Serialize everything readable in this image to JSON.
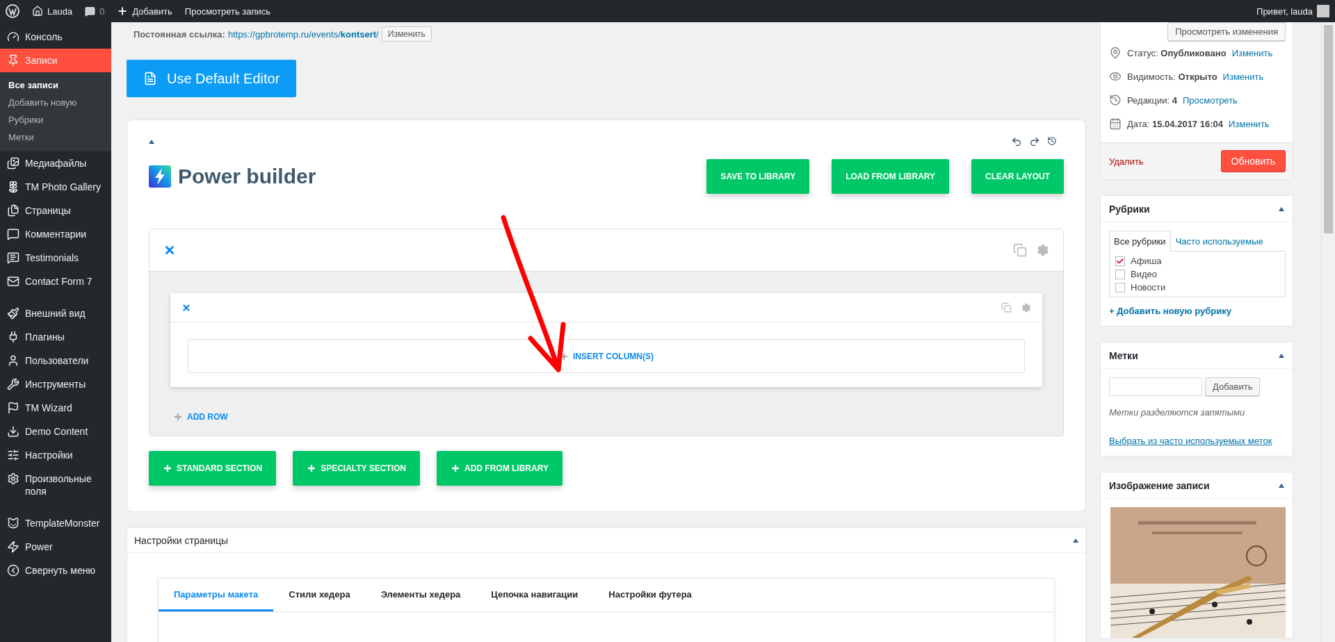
{
  "admin_bar": {
    "site": "Lauda",
    "comments": "0",
    "add": "Добавить",
    "view": "Просмотреть запись",
    "greeting": "Привет, lauda"
  },
  "sidebar": {
    "groups": [
      [
        {
          "label": "Консоль",
          "selected": false
        },
        {
          "label": "Записи",
          "selected": true,
          "children": [
            {
              "label": "Все записи",
              "selected": true
            },
            {
              "label": "Добавить новую",
              "selected": false
            },
            {
              "label": "Рубрики",
              "selected": false
            },
            {
              "label": "Метки",
              "selected": false
            }
          ]
        },
        {
          "label": "Медиафайлы",
          "selected": false
        },
        {
          "label": "TM Photo Gallery",
          "selected": false
        },
        {
          "label": "Страницы",
          "selected": false
        },
        {
          "label": "Комментарии",
          "selected": false
        },
        {
          "label": "Testimonials",
          "selected": false
        },
        {
          "label": "Contact Form 7",
          "selected": false
        }
      ],
      [
        {
          "label": "Внешний вид",
          "selected": false
        },
        {
          "label": "Плагины",
          "selected": false
        },
        {
          "label": "Пользователи",
          "selected": false
        },
        {
          "label": "Инструменты",
          "selected": false
        },
        {
          "label": "TM Wizard",
          "selected": false
        },
        {
          "label": "Demo Content",
          "selected": false
        },
        {
          "label": "Настройки",
          "selected": false
        },
        {
          "label": "Произвольные поля",
          "selected": false
        }
      ],
      [
        {
          "label": "TemplateMonster",
          "selected": false
        },
        {
          "label": "Power",
          "selected": false
        },
        {
          "label": "Свернуть меню",
          "selected": false
        }
      ]
    ]
  },
  "permalink": {
    "label": "Постоянная ссылка:",
    "url_start": "https://gpbrotemp.ru/events/",
    "url_slug": "kontsert",
    "url_end": "/",
    "button": "Изменить"
  },
  "default_editor_button": "Use Default Editor",
  "builder": {
    "title": "Power builder",
    "buttons": [
      "SAVE TO LIBRARY",
      "LOAD FROM LIBRARY",
      "CLEAR LAYOUT"
    ],
    "insert_column": "INSERT COLUMN(S)",
    "add_row": "ADD ROW",
    "section_buttons": [
      "STANDARD SECTION",
      "SPECIALTY SECTION",
      "ADD FROM LIBRARY"
    ]
  },
  "page_settings": {
    "title": "Настройки страницы",
    "tabs": [
      {
        "label": "Параметры макета",
        "selected": true
      },
      {
        "label": "Стили хедера",
        "selected": false
      },
      {
        "label": "Элементы хедера",
        "selected": false
      },
      {
        "label": "Цепочка навигации",
        "selected": false
      },
      {
        "label": "Настройки футера",
        "selected": false
      }
    ]
  },
  "publish": {
    "preview_button": "Просмотреть изменения",
    "rows": [
      {
        "label": "Статус:",
        "value": "Опубликовано",
        "link": "Изменить"
      },
      {
        "label": "Видимость:",
        "value": "Открыто",
        "link": "Изменить"
      },
      {
        "label": "Редакции:",
        "value": "4",
        "link": "Просмотреть"
      },
      {
        "label": "Дата:",
        "value": "15.04.2017 16:04",
        "link": "Изменить"
      }
    ],
    "delete": "Удалить",
    "update": "Обновить"
  },
  "categories": {
    "title": "Рубрики",
    "tabs": [
      {
        "label": "Все рубрики",
        "selected": true
      },
      {
        "label": "Часто используемые",
        "selected": false
      }
    ],
    "items": [
      {
        "label": "Афиша",
        "checked": true
      },
      {
        "label": "Видео",
        "checked": false
      },
      {
        "label": "Новости",
        "checked": false
      }
    ],
    "add_link": "+ Добавить новую рубрику"
  },
  "tags": {
    "title": "Метки",
    "button": "Добавить",
    "hint": "Метки разделяются запятыми",
    "link": "Выбрать из часто используемых меток"
  },
  "featured_image": {
    "title": "Изображение записи"
  }
}
